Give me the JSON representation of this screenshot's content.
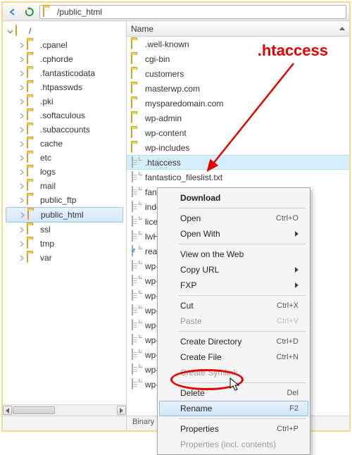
{
  "toolbar": {
    "path": "/public_html"
  },
  "tree": {
    "root_label": "/",
    "items": [
      {
        "label": ".cpanel",
        "selected": false
      },
      {
        "label": ".cphorde",
        "selected": false
      },
      {
        "label": ".fantasticodata",
        "selected": false
      },
      {
        "label": ".htpasswds",
        "selected": false
      },
      {
        "label": ".pki",
        "selected": false
      },
      {
        "label": ".softaculous",
        "selected": false
      },
      {
        "label": ".subaccounts",
        "selected": false
      },
      {
        "label": "cache",
        "selected": false
      },
      {
        "label": "etc",
        "selected": false
      },
      {
        "label": "logs",
        "selected": false
      },
      {
        "label": "mail",
        "selected": false
      },
      {
        "label": "public_ftp",
        "selected": false
      },
      {
        "label": "public_html",
        "selected": true
      },
      {
        "label": "ssl",
        "selected": false
      },
      {
        "label": "tmp",
        "selected": false
      },
      {
        "label": "var",
        "selected": false
      }
    ]
  },
  "list": {
    "header": "Name",
    "items": [
      {
        "label": ".well-known",
        "type": "folder",
        "selected": false
      },
      {
        "label": "cgi-bin",
        "type": "folder",
        "selected": false
      },
      {
        "label": "customers",
        "type": "folder",
        "selected": false
      },
      {
        "label": "masterwp.com",
        "type": "folder",
        "selected": false
      },
      {
        "label": "mysparedomain.com",
        "type": "folder",
        "selected": false
      },
      {
        "label": "wp-admin",
        "type": "folder",
        "selected": false
      },
      {
        "label": "wp-content",
        "type": "folder",
        "selected": false
      },
      {
        "label": "wp-includes",
        "type": "folder",
        "selected": false
      },
      {
        "label": ".htaccess",
        "type": "file",
        "selected": true
      },
      {
        "label": "fantastico_fileslist.txt",
        "type": "file",
        "selected": false
      },
      {
        "label": "fantversion.php",
        "type": "file",
        "selected": false
      },
      {
        "label": "index.php",
        "type": "file",
        "selected": false
      },
      {
        "label": "license.txt",
        "type": "file",
        "selected": false
      },
      {
        "label": "lwHostsCheck.php",
        "type": "file",
        "selected": false
      },
      {
        "label": "readme.html",
        "type": "html",
        "selected": false
      },
      {
        "label": "wp-activate.php",
        "type": "file",
        "selected": false
      },
      {
        "label": "wp-blog-header.php",
        "type": "file",
        "selected": false
      },
      {
        "label": "wp-comments-post.php",
        "type": "file",
        "selected": false
      },
      {
        "label": "wp-config-sample.php",
        "type": "file",
        "selected": false
      },
      {
        "label": "wp-config.php",
        "type": "file",
        "selected": false
      },
      {
        "label": "wp-cron.php",
        "type": "file",
        "selected": false
      },
      {
        "label": "wp-links-opml.php",
        "type": "file",
        "selected": false
      },
      {
        "label": "wp-load.php",
        "type": "file",
        "selected": false
      },
      {
        "label": "wp-login.php",
        "type": "file",
        "selected": false
      }
    ]
  },
  "ctx": {
    "download": "Download",
    "open": "Open",
    "open_k": "Ctrl+O",
    "openwith": "Open With",
    "viewweb": "View on the Web",
    "copyurl": "Copy URL",
    "fxp": "FXP",
    "cut": "Cut",
    "cut_k": "Ctrl+X",
    "paste": "Paste",
    "paste_k": "Ctrl+V",
    "createdir": "Create Directory",
    "createdir_k": "Ctrl+D",
    "createfile": "Create File",
    "createfile_k": "Ctrl+N",
    "symlink": "Create Symlink",
    "delete": "Delete",
    "delete_k": "Del",
    "rename": "Rename",
    "rename_k": "F2",
    "props": "Properties",
    "props_k": "Ctrl+P",
    "propsincl": "Properties (incl. contents)"
  },
  "callout": ".htaccess",
  "status": {
    "binary": "Binary"
  }
}
